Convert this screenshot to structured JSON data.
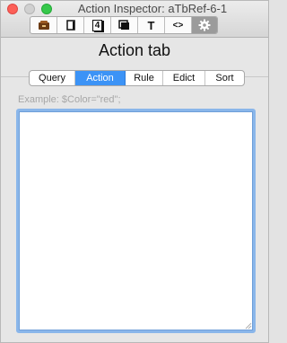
{
  "window": {
    "title": "Action Inspector: aTbRef-6-1"
  },
  "toolbar": {
    "buttons": [
      {
        "name": "properties-tab",
        "icon": "drawer-icon"
      },
      {
        "name": "appearance-tab",
        "icon": "page-icon"
      },
      {
        "name": "number-tab",
        "icon": "number-4-icon",
        "glyph": "4"
      },
      {
        "name": "stack-tab",
        "icon": "stack-icon"
      },
      {
        "name": "text-tab",
        "icon": "text-t-icon",
        "glyph": "T"
      },
      {
        "name": "code-tab",
        "icon": "code-brackets-icon",
        "glyph": "<>"
      },
      {
        "name": "action-tab",
        "icon": "gear-icon",
        "selected": true
      }
    ]
  },
  "panel": {
    "heading": "Action tab"
  },
  "tabs": [
    {
      "label": "Query",
      "active": false
    },
    {
      "label": "Action",
      "active": true
    },
    {
      "label": "Rule",
      "active": false
    },
    {
      "label": "Edict",
      "active": false
    },
    {
      "label": "Sort",
      "active": false
    }
  ],
  "editor": {
    "placeholder": "Example: $Color=\"red\";",
    "value": ""
  },
  "colors": {
    "accent": "#3c93f6",
    "focus_ring": "#8ab6ea"
  }
}
